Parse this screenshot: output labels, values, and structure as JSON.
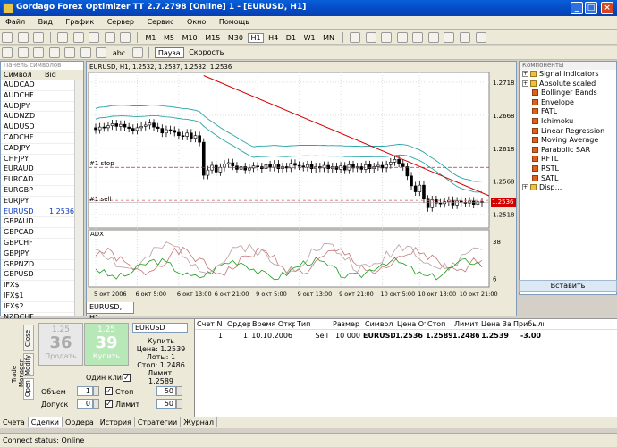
{
  "window": {
    "title": "Gordago Forex Optimizer TT 2.7.2798 [Online] 1 - [EURUSD, H1]"
  },
  "menu": [
    "Файл",
    "Вид",
    "График",
    "Сервер",
    "Сервис",
    "Окно",
    "Помощь"
  ],
  "toolbar": {
    "timeframes": [
      "M1",
      "M5",
      "M10",
      "M15",
      "M30",
      "H1",
      "H4",
      "D1",
      "W1",
      "MN"
    ],
    "selected_timeframe": "H1",
    "text_tool": "abc",
    "pause_label": "Пауза",
    "speed_label": "Скорость"
  },
  "symbols_panel": {
    "title": "Панель символов",
    "col_symbol": "Символ",
    "col_bid": "Bid",
    "rows": [
      {
        "name": "AUDCAD",
        "bid": ""
      },
      {
        "name": "AUDCHF",
        "bid": ""
      },
      {
        "name": "AUDJPY",
        "bid": ""
      },
      {
        "name": "AUDNZD",
        "bid": ""
      },
      {
        "name": "AUDUSD",
        "bid": ""
      },
      {
        "name": "CADCHF",
        "bid": ""
      },
      {
        "name": "CADJPY",
        "bid": ""
      },
      {
        "name": "CHFJPY",
        "bid": ""
      },
      {
        "name": "EURAUD",
        "bid": ""
      },
      {
        "name": "EURCAD",
        "bid": ""
      },
      {
        "name": "EURGBP",
        "bid": ""
      },
      {
        "name": "EURJPY",
        "bid": ""
      },
      {
        "name": "EURUSD",
        "bid": "1.2536",
        "selected": true
      },
      {
        "name": "GBPAUD",
        "bid": ""
      },
      {
        "name": "GBPCAD",
        "bid": ""
      },
      {
        "name": "GBPCHF",
        "bid": ""
      },
      {
        "name": "GBPJPY",
        "bid": ""
      },
      {
        "name": "GBPNZD",
        "bid": ""
      },
      {
        "name": "GBPUSD",
        "bid": ""
      },
      {
        "name": "IFX$",
        "bid": ""
      },
      {
        "name": "IFX$1",
        "bid": ""
      },
      {
        "name": "IFX$2",
        "bid": ""
      },
      {
        "name": "NZDCHF",
        "bid": ""
      }
    ]
  },
  "chart": {
    "header": "EURUSD, H1, 1.2532, 1.2537, 1.2532, 1.2536",
    "tab": "EURUSD, H1",
    "stop_label": "#1 stop",
    "sell_label": "#1 sell",
    "last_price_tag": "1.2536",
    "indicator_label": "ADX",
    "colors": {
      "trendline": "#d40000",
      "bands": "#2aa5a5",
      "price_tag": "#d40000",
      "adx_green": "#1a9a1a",
      "adx_red": "#c0392b"
    }
  },
  "chart_data": {
    "type": "candlestick",
    "symbol": "EURUSD",
    "timeframe": "H1",
    "price_axis_ticks": [
      "1.2718",
      "1.2668",
      "1.2618",
      "1.2568",
      "1.2518"
    ],
    "time_axis_ticks": [
      "5 окт 2006",
      "6 окт 5:00",
      "6 окт 13:00",
      "6 окт 21:00",
      "9 окт 5:00",
      "9 окт 13:00",
      "9 окт 21:00",
      "10 окт 5:00",
      "10 окт 13:00",
      "10 окт 21:00"
    ],
    "levels": {
      "stop": 1.2589,
      "sell": 1.2539,
      "last": 1.2536
    },
    "trendline": {
      "from": 1.2728,
      "to": 1.2546
    },
    "close": [
      1.2646,
      1.265,
      1.2649,
      1.2652,
      1.2655,
      1.2651,
      1.2654,
      1.265,
      1.2648,
      1.2645,
      1.2649,
      1.2651,
      1.2653,
      1.2656,
      1.265,
      1.2648,
      1.2641,
      1.2646,
      1.2645,
      1.2642,
      1.2637,
      1.2636,
      1.2641,
      1.2633,
      1.2637,
      1.2627,
      1.2577,
      1.2585,
      1.2592,
      1.2582,
      1.2589,
      1.2594,
      1.2596,
      1.2591,
      1.2586,
      1.259,
      1.2585,
      1.2588,
      1.2591,
      1.259,
      1.2587,
      1.2593,
      1.2589,
      1.2594,
      1.2587,
      1.259,
      1.2588,
      1.2595,
      1.2592,
      1.2591,
      1.2589,
      1.2593,
      1.2587,
      1.259,
      1.2588,
      1.2592,
      1.2587,
      1.259,
      1.2586,
      1.2591,
      1.2585,
      1.2593,
      1.2588,
      1.259,
      1.2586,
      1.2593,
      1.2587,
      1.259,
      1.2592,
      1.2588,
      1.2593,
      1.2597,
      1.2601,
      1.2595,
      1.259,
      1.2576,
      1.2561,
      1.2552,
      1.2562,
      1.2541,
      1.2528,
      1.254,
      1.2535,
      1.2534,
      1.2537,
      1.2539,
      1.2532,
      1.2538,
      1.2536,
      1.2535,
      1.2538,
      1.2533,
      1.2537,
      1.2536
    ],
    "adx_axis_ticks": [
      "38",
      "6"
    ]
  },
  "components": {
    "title": "Компоненты",
    "items": [
      {
        "label": "Signal indicators",
        "level": 0,
        "group": true
      },
      {
        "label": "Absolute scaled",
        "level": 0,
        "group": true
      },
      {
        "label": "Bollinger Bands",
        "level": 1
      },
      {
        "label": "Envelope",
        "level": 1
      },
      {
        "label": "FATL",
        "level": 1
      },
      {
        "label": "Ichimoku",
        "level": 1
      },
      {
        "label": "Linear Regression",
        "level": 1
      },
      {
        "label": "Moving Average",
        "level": 1
      },
      {
        "label": "Parabolic SAR",
        "level": 1
      },
      {
        "label": "RFTL",
        "level": 1
      },
      {
        "label": "RSTL",
        "level": 1
      },
      {
        "label": "SATL",
        "level": 1
      },
      {
        "label": "Disp...",
        "level": 0,
        "group": true
      }
    ],
    "insert_label": "Вставить"
  },
  "trade_panel": {
    "tabs": [
      "Close",
      "Modify",
      "Open"
    ],
    "manager_label": "Trade Manager",
    "sell": {
      "small": "1.25",
      "big": "36",
      "label": "Продать"
    },
    "buy": {
      "small": "1.25",
      "big": "39",
      "label": "Купить"
    },
    "symbol": "EURUSD",
    "order_info": {
      "title": "Купить",
      "price": "Цена: 1.2539",
      "lots": "Лоты: 1",
      "stop": "Стоп: 1.2486",
      "limit": "Лимит: 1.2589"
    },
    "one_click": "Один клик",
    "volume_label": "Объем",
    "volume": "1",
    "slippage_label": "Допуск",
    "slippage": "0",
    "stop_label": "Стоп",
    "stop_value": "50",
    "limit_label": "Лимит",
    "limit_value": "50"
  },
  "orders": {
    "headers": [
      "Счет N",
      "Ордер",
      "Время Откр",
      "Тип",
      "Размер",
      "Символ",
      "Цена От",
      "Стоп",
      "Лимит",
      "Цена Зак",
      "Прибыль"
    ],
    "rows": [
      [
        "1",
        "1",
        "10.10.2006",
        "Sell",
        "10 000",
        "EURUSD",
        "1.2536",
        "1.2589",
        "1.2486",
        "1.2539",
        "-3.00"
      ]
    ]
  },
  "bottom_tabs": [
    "Счета",
    "Сделки",
    "Ордера",
    "История",
    "Стратегии",
    "Журнал"
  ],
  "active_bottom_tab": "Сделки",
  "status": {
    "label": "Connect status:",
    "value": "Online"
  }
}
